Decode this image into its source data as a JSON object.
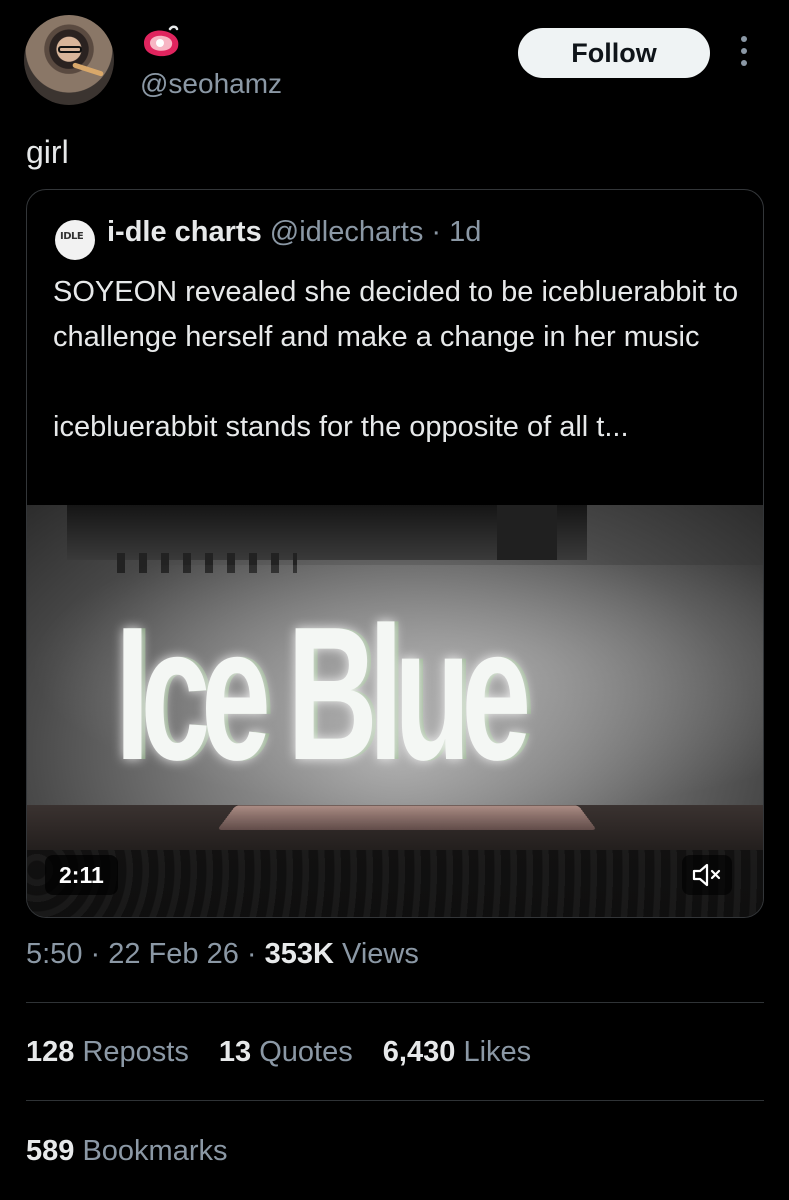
{
  "author": {
    "handle": "@seohamz",
    "emoji": "steak-emoji"
  },
  "follow_label": "Follow",
  "tweet_text": "girl",
  "quoted": {
    "avatar_text": "IDLE",
    "name": "i-dle charts",
    "handle": "@idlecharts",
    "time": "· 1d",
    "paragraph1": "SOYEON revealed she decided to be icebluerabbit to challenge herself and make a change in her music",
    "paragraph2": "icebluerabbit stands for the opposite of all t...",
    "media": {
      "stage_text": "Ice Blue",
      "duration": "2:11",
      "mute_icon": "speaker-muted-icon"
    }
  },
  "meta": {
    "time": "5:50",
    "date": "22 Feb 26",
    "views_count": "353K",
    "views_label": "Views"
  },
  "stats": {
    "reposts_count": "128",
    "reposts_label": "Reposts",
    "quotes_count": "13",
    "quotes_label": "Quotes",
    "likes_count": "6,430",
    "likes_label": "Likes",
    "bookmarks_count": "589",
    "bookmarks_label": "Bookmarks"
  },
  "colors": {
    "background": "#000000",
    "text_primary": "#e7e9ea",
    "text_secondary": "#8b98a5",
    "follow_bg": "#eff3f4",
    "border": "#333639"
  }
}
